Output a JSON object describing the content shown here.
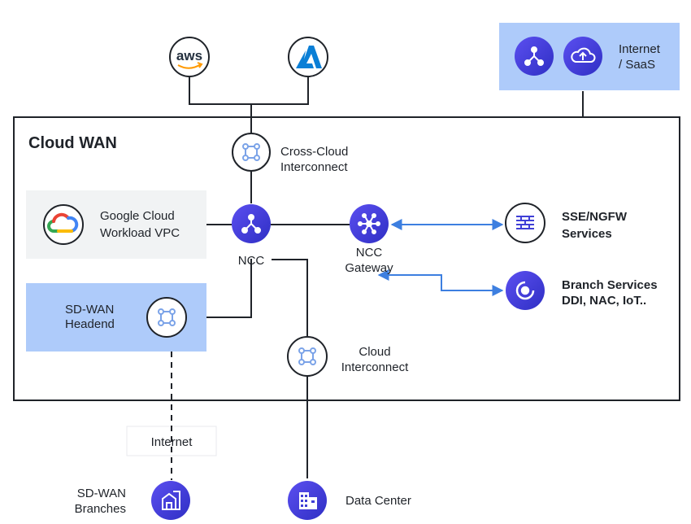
{
  "title": "Cloud WAN",
  "nodes": {
    "aws": {
      "text": "aws",
      "icon": "aws-icon"
    },
    "azure": {
      "icon": "azure-icon"
    },
    "internet_saas": {
      "label_line1": "Internet",
      "label_line2": "/ SaaS",
      "icons": [
        "hub-icon",
        "cloud-upload-icon"
      ]
    },
    "cross_cloud": {
      "label_line1": "Cross-Cloud",
      "label_line2": "Interconnect",
      "icon": "interconnect-icon"
    },
    "google_cloud": {
      "label_line1": "Google Cloud",
      "label_line2": "Workload VPC",
      "icon": "google-cloud-icon"
    },
    "ncc": {
      "label": "NCC",
      "icon": "hub-icon"
    },
    "ncc_gateway": {
      "label_line1": "NCC",
      "label_line2": "Gateway",
      "icon": "gateway-icon"
    },
    "sse_ngfw": {
      "label_line1": "SSE/NGFW",
      "label_line2": "Services",
      "icon": "firewall-icon"
    },
    "branch_services": {
      "label_line1": "Branch Services",
      "label_line2": "DDI, NAC, IoT..",
      "icon": "branch-services-icon"
    },
    "sdwan_headend": {
      "label_line1": "SD-WAN",
      "label_line2": "Headend",
      "icon": "interconnect-icon"
    },
    "cloud_interconnect": {
      "label_line1": "Cloud",
      "label_line2": "Interconnect",
      "icon": "interconnect-icon"
    },
    "internet": {
      "label": "Internet"
    },
    "sdwan_branches": {
      "label_line1": "SD-WAN",
      "label_line2": "Branches",
      "icon": "branch-building-icon"
    },
    "data_center": {
      "label": "Data Center",
      "icon": "data-center-icon"
    }
  },
  "colors": {
    "highlight_panel": "#aecbfa",
    "gray_panel": "#f1f3f4",
    "node_purple": "#3f3fd6",
    "arrow_blue": "#3d7fe0",
    "interconnect_blue": "#7ba3e8"
  }
}
